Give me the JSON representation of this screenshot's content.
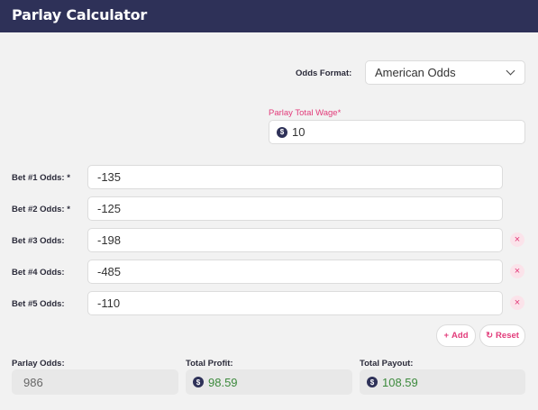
{
  "header": {
    "title": "Parlay Calculator"
  },
  "odds_format": {
    "label": "Odds Format:",
    "value": "American Odds"
  },
  "wager": {
    "label": "Parlay Total Wage*",
    "currency_symbol": "$",
    "value": "10"
  },
  "bets": [
    {
      "label": "Bet #1 Odds: *",
      "value": "-135",
      "removable": false
    },
    {
      "label": "Bet #2 Odds: *",
      "value": "-125",
      "removable": false
    },
    {
      "label": "Bet #3 Odds:",
      "value": "-198",
      "removable": true
    },
    {
      "label": "Bet #4 Odds:",
      "value": "-485",
      "removable": true
    },
    {
      "label": "Bet #5 Odds:",
      "value": "-110",
      "removable": true
    }
  ],
  "actions": {
    "add_label": "Add",
    "reset_label": "Reset",
    "remove_glyph": "×"
  },
  "results": {
    "parlay_odds": {
      "label": "Parlay Odds:",
      "value": "986"
    },
    "total_profit": {
      "label": "Total Profit:",
      "currency_symbol": "$",
      "value": "98.59"
    },
    "total_payout": {
      "label": "Total Payout:",
      "currency_symbol": "$",
      "value": "108.59"
    }
  },
  "colors": {
    "header": "#2e3158",
    "accent": "#e23b7a",
    "result_value": "#3c8a3c"
  },
  "icons": {
    "add": "plus-icon",
    "reset": "reset-icon",
    "remove": "close-icon",
    "currency": "dollar-icon",
    "select": "chevron-down-icon"
  }
}
